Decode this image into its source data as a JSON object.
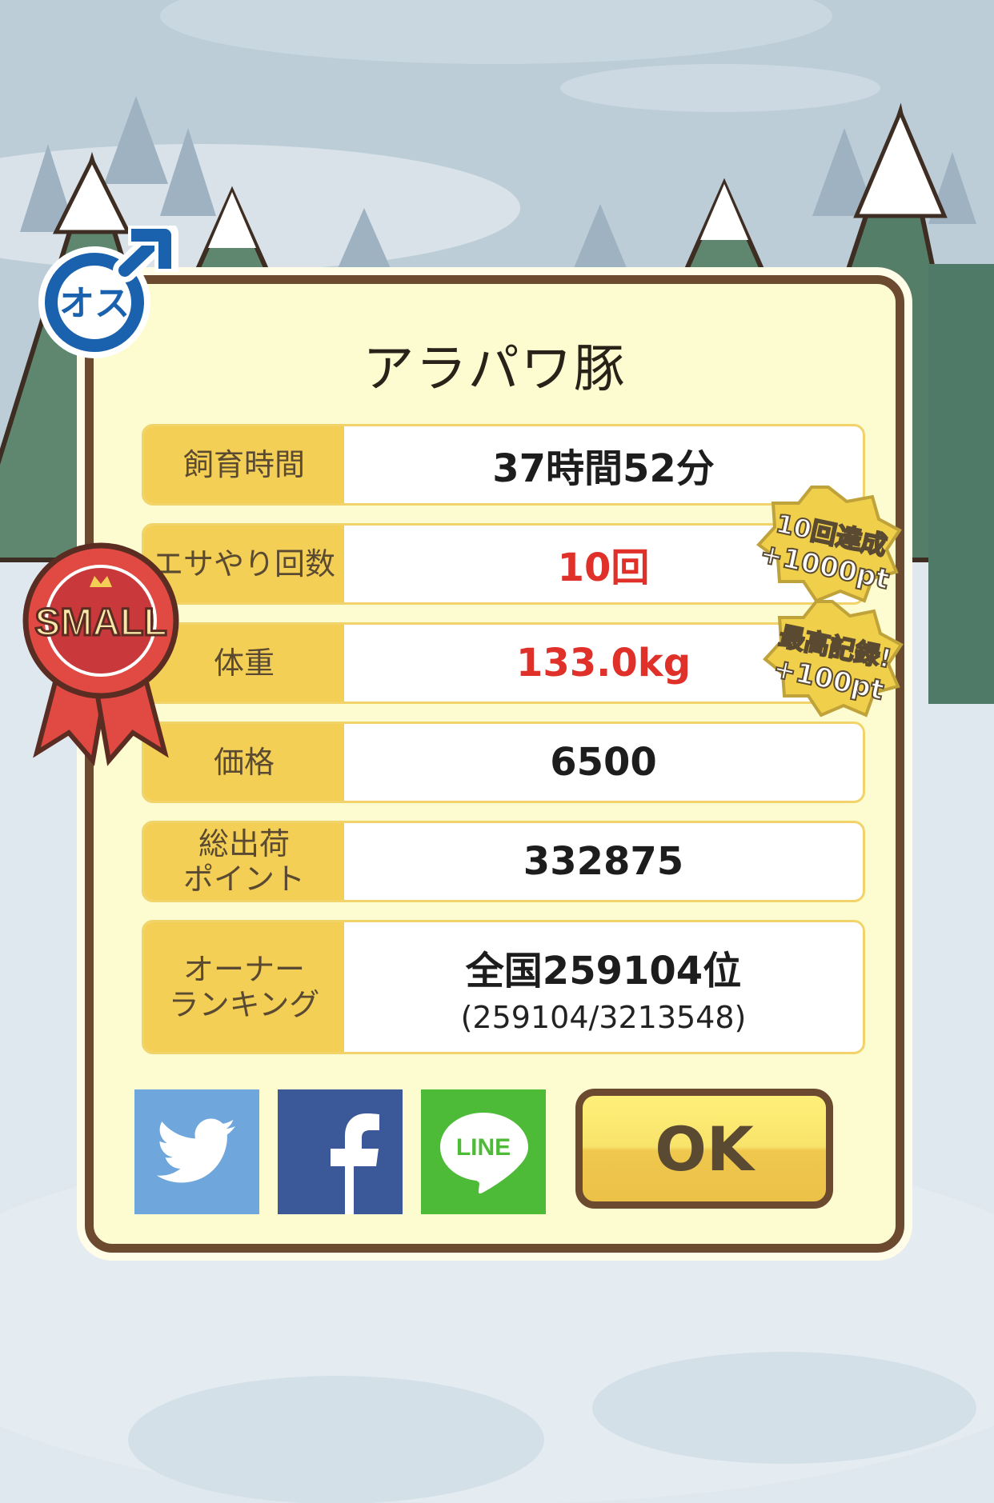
{
  "pig": {
    "name": "アラパワ豚",
    "gender_badge": "オス",
    "size_ribbon": "SMALL"
  },
  "stats": [
    {
      "label": "飼育時間",
      "value": "37時間52分",
      "highlight": false
    },
    {
      "label": "エサやり回数",
      "value": "10回",
      "highlight": true
    },
    {
      "label": "体重",
      "value": "133.0kg",
      "highlight": true
    },
    {
      "label": "価格",
      "value": "6500",
      "highlight": false
    },
    {
      "label": "総出荷\nポイント",
      "value": "332875",
      "highlight": false
    }
  ],
  "ranking": {
    "label": "オーナー\nランキング",
    "rank": "全国259104位",
    "detail": "(259104/3213548)"
  },
  "bonuses": [
    {
      "line1": "10回達成",
      "line2": "+1000pt"
    },
    {
      "line1": "最高記録!",
      "line2": "+100pt"
    }
  ],
  "share": {
    "twitter_icon": "twitter-bird-icon",
    "facebook_icon": "facebook-f-icon",
    "line_label": "LINE"
  },
  "ok_label": "OK",
  "colors": {
    "panel_bg": "#fdfbd0",
    "panel_border": "#6b4a30",
    "label_bg": "#f4cf55",
    "highlight_text": "#e0302a",
    "twitter": "#6fa7dd",
    "facebook": "#3b5998",
    "line": "#4dbb37",
    "ribbon": "#e04a43",
    "gender_blue": "#1a62ae"
  }
}
